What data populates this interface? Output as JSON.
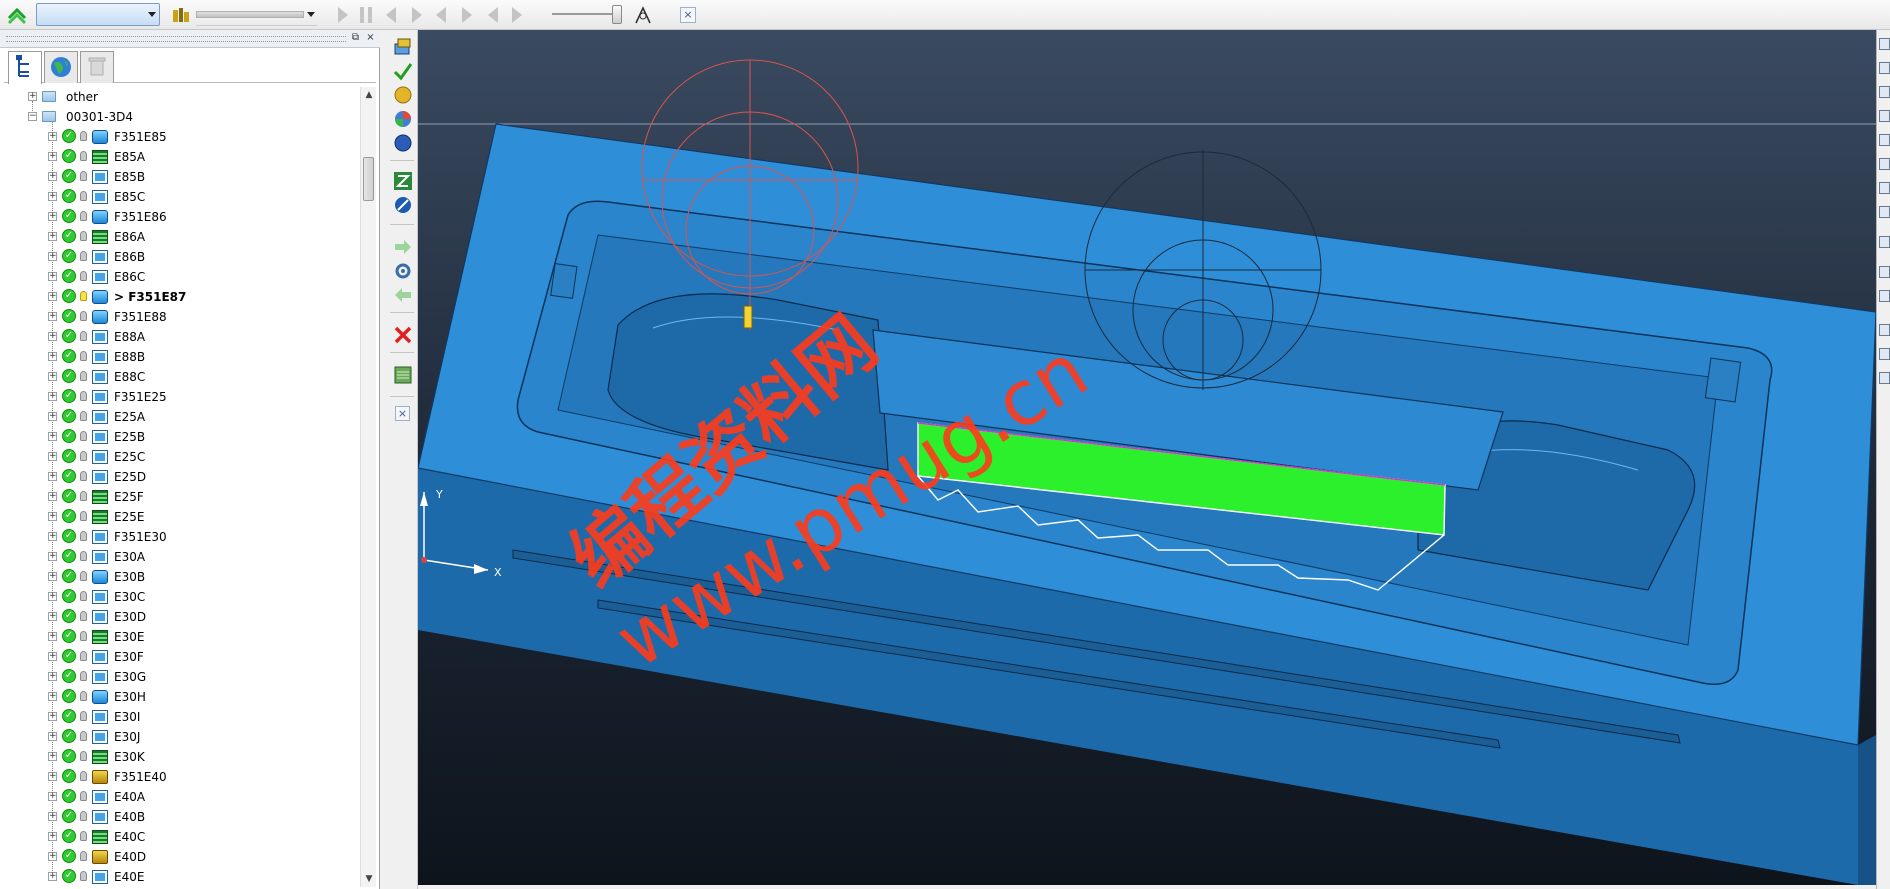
{
  "toolbar": {
    "combo_value": "",
    "close_label": "×"
  },
  "panel": {
    "float_label": "⧉",
    "close_label": "×"
  },
  "tree": {
    "nodes": [
      {
        "label": "other",
        "level": 0,
        "kind": "folder"
      },
      {
        "label": "00301-3D4",
        "level": 0,
        "kind": "folder"
      },
      {
        "label": "F351E85",
        "level": 1,
        "kind": "a"
      },
      {
        "label": "E85A",
        "level": 1,
        "kind": "b"
      },
      {
        "label": "E85B",
        "level": 1,
        "kind": "c"
      },
      {
        "label": "E85C",
        "level": 1,
        "kind": "c"
      },
      {
        "label": "F351E86",
        "level": 1,
        "kind": "a"
      },
      {
        "label": "E86A",
        "level": 1,
        "kind": "b"
      },
      {
        "label": "E86B",
        "level": 1,
        "kind": "c"
      },
      {
        "label": "E86C",
        "level": 1,
        "kind": "c"
      },
      {
        "label": "> F351E87",
        "level": 1,
        "kind": "a",
        "active": true
      },
      {
        "label": "F351E88",
        "level": 1,
        "kind": "a"
      },
      {
        "label": "E88A",
        "level": 1,
        "kind": "c"
      },
      {
        "label": "E88B",
        "level": 1,
        "kind": "c"
      },
      {
        "label": "E88C",
        "level": 1,
        "kind": "c"
      },
      {
        "label": "F351E25",
        "level": 1,
        "kind": "c"
      },
      {
        "label": "E25A",
        "level": 1,
        "kind": "c"
      },
      {
        "label": "E25B",
        "level": 1,
        "kind": "c"
      },
      {
        "label": "E25C",
        "level": 1,
        "kind": "c"
      },
      {
        "label": "E25D",
        "level": 1,
        "kind": "c"
      },
      {
        "label": "E25F",
        "level": 1,
        "kind": "b"
      },
      {
        "label": "E25E",
        "level": 1,
        "kind": "b"
      },
      {
        "label": "F351E30",
        "level": 1,
        "kind": "c"
      },
      {
        "label": "E30A",
        "level": 1,
        "kind": "c"
      },
      {
        "label": "E30B",
        "level": 1,
        "kind": "a"
      },
      {
        "label": "E30C",
        "level": 1,
        "kind": "c"
      },
      {
        "label": "E30D",
        "level": 1,
        "kind": "c"
      },
      {
        "label": "E30E",
        "level": 1,
        "kind": "b"
      },
      {
        "label": "E30F",
        "level": 1,
        "kind": "c"
      },
      {
        "label": "E30G",
        "level": 1,
        "kind": "c"
      },
      {
        "label": "E30H",
        "level": 1,
        "kind": "a"
      },
      {
        "label": "E30I",
        "level": 1,
        "kind": "c"
      },
      {
        "label": "E30J",
        "level": 1,
        "kind": "c"
      },
      {
        "label": "E30K",
        "level": 1,
        "kind": "b"
      },
      {
        "label": "F351E40",
        "level": 1,
        "kind": "e"
      },
      {
        "label": "E40A",
        "level": 1,
        "kind": "c"
      },
      {
        "label": "E40B",
        "level": 1,
        "kind": "c"
      },
      {
        "label": "E40C",
        "level": 1,
        "kind": "b"
      },
      {
        "label": "E40D",
        "level": 1,
        "kind": "e"
      },
      {
        "label": "E40E",
        "level": 1,
        "kind": "c"
      }
    ]
  },
  "viewport": {
    "axis_x_label": "X",
    "axis_y_label": "Y",
    "watermark_url": "www.pmug.cn",
    "watermark_cn": "编程资料网"
  },
  "colors": {
    "mold_blue": "#2e8fd8",
    "mold_dark": "#1b5f99",
    "highlight_green": "#2cf02c",
    "watermark_red": "#ff3b1a",
    "background_top": "#3a4a60"
  }
}
